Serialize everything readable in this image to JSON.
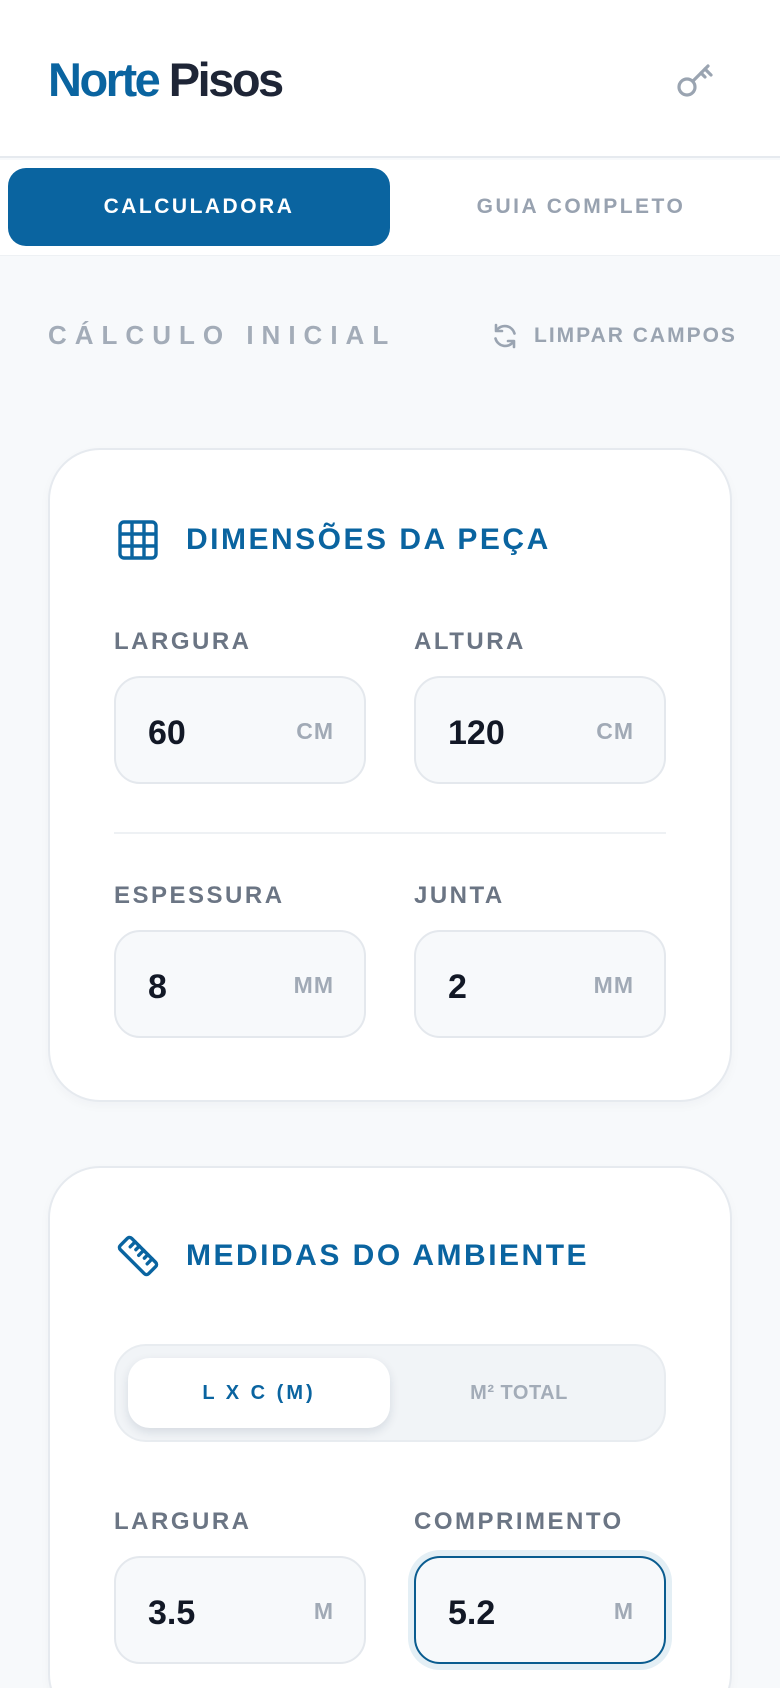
{
  "header": {
    "brand_primary": "Norte",
    "brand_secondary": "Pisos",
    "key_icon": "key-icon"
  },
  "tabs": [
    {
      "label": "CALCULADORA",
      "active": true
    },
    {
      "label": "GUIA COMPLETO",
      "active": false
    }
  ],
  "section": {
    "title": "CÁLCULO INICIAL",
    "clear_label": "LIMPAR CAMPOS",
    "clear_icon": "refresh-icon"
  },
  "piece": {
    "title": "DIMENSÕES DA PEÇA",
    "icon": "grid-icon",
    "fields": [
      {
        "label": "LARGURA",
        "value": "60",
        "unit": "CM"
      },
      {
        "label": "ALTURA",
        "value": "120",
        "unit": "CM"
      },
      {
        "label": "ESPESSURA",
        "value": "8",
        "unit": "MM"
      },
      {
        "label": "JUNTA",
        "value": "2",
        "unit": "MM"
      }
    ]
  },
  "room": {
    "title": "MEDIDAS DO AMBIENTE",
    "icon": "ruler-icon",
    "modes": [
      {
        "label": "L X C (M)",
        "active": true
      },
      {
        "label": "M² TOTAL",
        "active": false
      }
    ],
    "fields": [
      {
        "label": "LARGURA",
        "value": "3.5",
        "unit": "M"
      },
      {
        "label": "COMPRIMENTO",
        "value": "5.2",
        "unit": "M",
        "focused": true
      }
    ]
  },
  "colors": {
    "primary": "#0a64a0",
    "brand_dark": "#1e2536",
    "muted": "#a3acb8",
    "background": "#f7f9fb"
  }
}
